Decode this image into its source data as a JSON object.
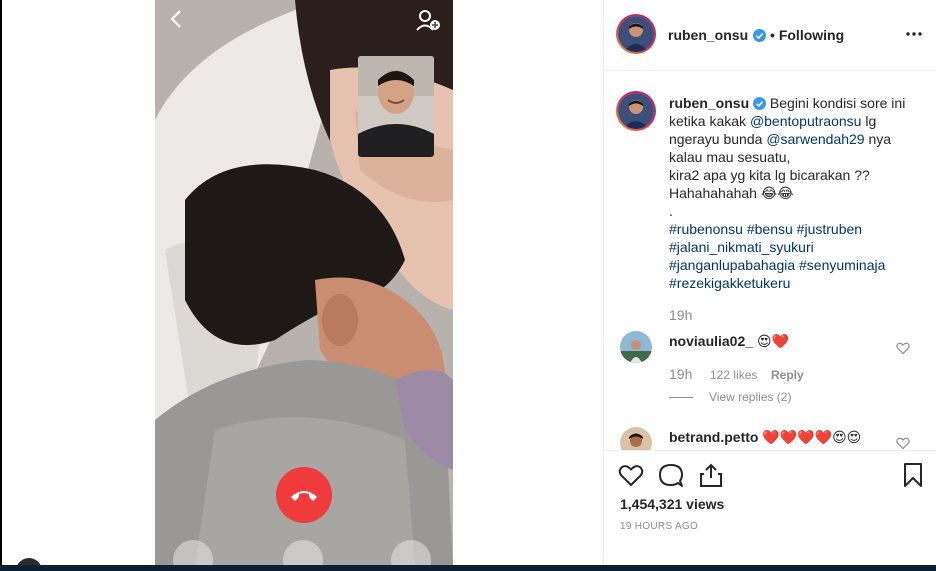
{
  "video": {
    "call_controls": [
      "back-icon",
      "add-user-icon",
      "end-call-icon",
      "camera-icon",
      "video-icon",
      "mute-icon"
    ]
  },
  "post": {
    "author": "ruben_onsu",
    "following_label": "• Following",
    "caption": {
      "line1_text": "Begini kondisi sore ini",
      "line2_pre": "ketika kakak ",
      "mention1": "@bentoputraonsu",
      "line2_post": " lg",
      "line3_pre": "ngerayu bunda ",
      "mention2": "@sarwendah29",
      "line3_post": " nya",
      "line4": "kalau mau sesuatu,",
      "line5": "kira2 apa yg kita lg bicarakan ??",
      "line6": "Hahahahahah 😂😂",
      "line7": ".",
      "tags_line1": [
        "#rubenonsu",
        "#bensu",
        "#justruben"
      ],
      "tags_line2": [
        "#jalani_nikmati_syukuri"
      ],
      "tags_line3": [
        "#janganlupabahagia",
        "#senyuminaja"
      ],
      "tags_line4": [
        "#rezekigakketukeru"
      ]
    },
    "caption_time": "19h"
  },
  "comments": [
    {
      "user": "noviaulia02_",
      "text": "😍❤️",
      "time": "19h",
      "likes": "122 likes",
      "reply_label": "Reply",
      "view_replies": "View replies (2)"
    },
    {
      "user": "betrand.petto",
      "text": "❤️❤️❤️❤️😍😍"
    }
  ],
  "stats": {
    "views": "1,454,321 views",
    "posted": "19 HOURS AGO"
  },
  "colors": {
    "accent_link": "#00376b",
    "verified": "#3897f0",
    "end_call": "#ef3b3b",
    "muted_text": "#8e8e8e"
  }
}
